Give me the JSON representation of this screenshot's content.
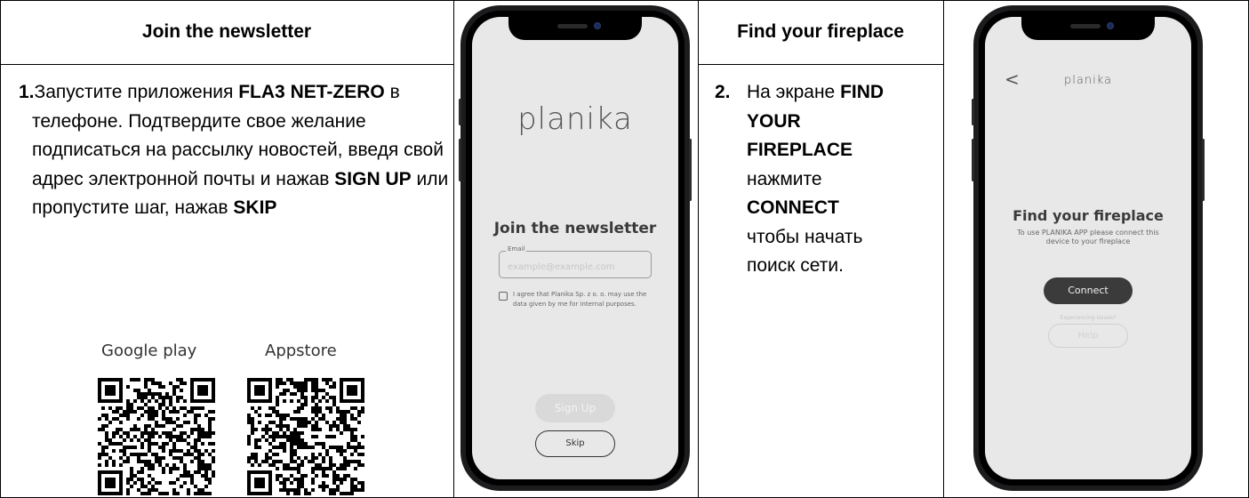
{
  "col1": {
    "title": "Join the newsletter",
    "step_number": "1.",
    "step_text_parts": [
      "Запустите приложения ",
      "FLA3 NET-ZERO",
      " в телефоне. Подтвердите свое желание подписаться на рассылку новостей, введя свой адрес электронной почты и нажав ",
      "SIGN UP",
      " или пропустите шаг, нажав ",
      "SKIP"
    ],
    "qr_google_label": "Google play",
    "qr_apple_label": "Appstore"
  },
  "phone1": {
    "logo": "planika",
    "heading": "Join the newsletter",
    "email_label": "Email",
    "email_placeholder": "example@example.com",
    "consent": "I agree that Planika Sp. z o. o. may use the data given by me for internal purposes.",
    "signup_label": "Sign Up",
    "skip_label": "Skip"
  },
  "col3": {
    "title": "Find your fireplace",
    "step_number": "2.",
    "lines": [
      "На экране ",
      "FIND",
      "YOUR",
      "FIREPLACE",
      "нажмите",
      "CONNECT",
      "чтобы начать",
      "поиск сети."
    ]
  },
  "phone2": {
    "back_glyph": "<",
    "logo": "planika",
    "heading": "Find your fireplace",
    "subtext": "To use PLANIKA APP please connect this device to your fireplace",
    "connect_label": "Connect",
    "issues_text": "Experiencing issues?",
    "help_label": "Help"
  }
}
